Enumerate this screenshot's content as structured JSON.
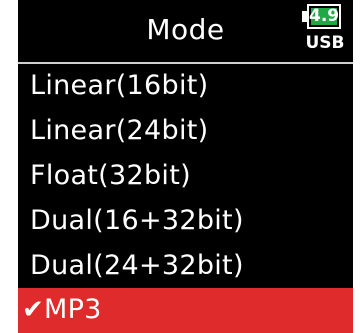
{
  "header": {
    "title": "Mode",
    "battery_level": "4.9",
    "power_source": "USB"
  },
  "colors": {
    "background": "#000000",
    "selected": "#df2b2b",
    "battery": "#1fa845"
  },
  "options": [
    {
      "label": "Linear(16bit)",
      "selected": false
    },
    {
      "label": "Linear(24bit)",
      "selected": false
    },
    {
      "label": "Float(32bit)",
      "selected": false
    },
    {
      "label": "Dual(16+32bit)",
      "selected": false
    },
    {
      "label": "Dual(24+32bit)",
      "selected": false
    },
    {
      "label": "MP3",
      "selected": true,
      "check": "✔"
    }
  ]
}
